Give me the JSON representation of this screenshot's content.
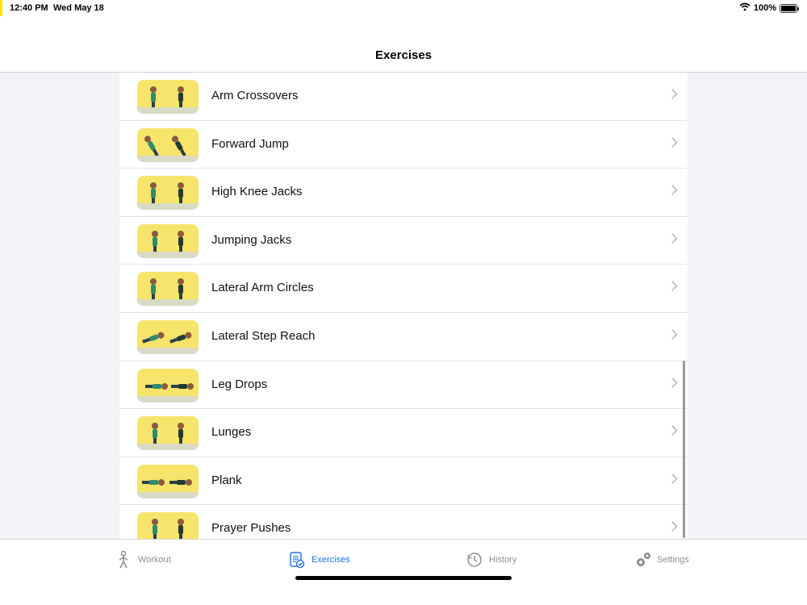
{
  "status_bar": {
    "time": "12:40 PM",
    "date": "Wed May 18",
    "battery": "100%"
  },
  "nav": {
    "title": "Exercises"
  },
  "exercises": [
    {
      "label": "Arm Crossovers"
    },
    {
      "label": "Forward Jump"
    },
    {
      "label": "High Knee Jacks"
    },
    {
      "label": "Jumping Jacks"
    },
    {
      "label": "Lateral Arm Circles"
    },
    {
      "label": "Lateral Step Reach"
    },
    {
      "label": "Leg Drops"
    },
    {
      "label": "Lunges"
    },
    {
      "label": "Plank"
    },
    {
      "label": "Prayer Pushes"
    }
  ],
  "tabs": [
    {
      "label": "Workout",
      "icon": "figure-icon"
    },
    {
      "label": "Exercises",
      "icon": "checklist-icon"
    },
    {
      "label": "History",
      "icon": "clock-refresh-icon"
    },
    {
      "label": "Settings",
      "icon": "gears-icon"
    }
  ],
  "colors": {
    "accent": "#1a73e8",
    "thumb_background": "#f7e46a"
  }
}
